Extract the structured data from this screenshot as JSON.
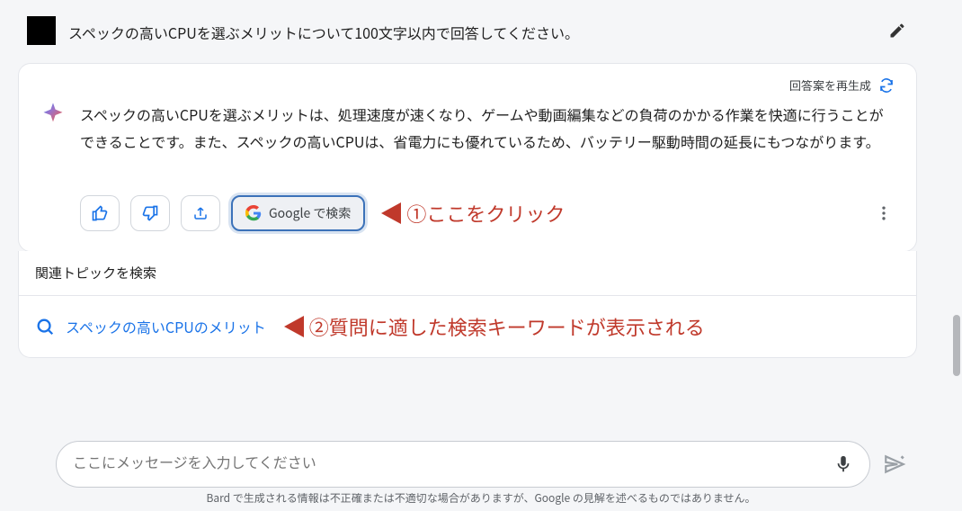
{
  "prompt": {
    "text": "スペックの高いCPUを選ぶメリットについて100文字以内で回答してください。"
  },
  "response": {
    "regenerate_label": "回答案を再生成",
    "text": "スペックの高いCPUを選ぶメリットは、処理速度が速くなり、ゲームや動画編集などの負荷のかかる作業を快適に行うことができることです。また、スペックの高いCPUは、省電力にも優れているため、バッテリー駆動時間の延長にもつながります。"
  },
  "actions": {
    "google_label": "Google で検索"
  },
  "annotations": {
    "one": "①ここをクリック",
    "two": "②質問に適した検索キーワードが表示される"
  },
  "related": {
    "header": "関連トピックを検索",
    "items": [
      "スペックの高いCPUのメリット"
    ]
  },
  "input": {
    "placeholder": "ここにメッセージを入力してください"
  },
  "disclaimer": "Bard で生成される情報は不正確または不適切な場合がありますが、Google の見解を述べるものではありません。"
}
